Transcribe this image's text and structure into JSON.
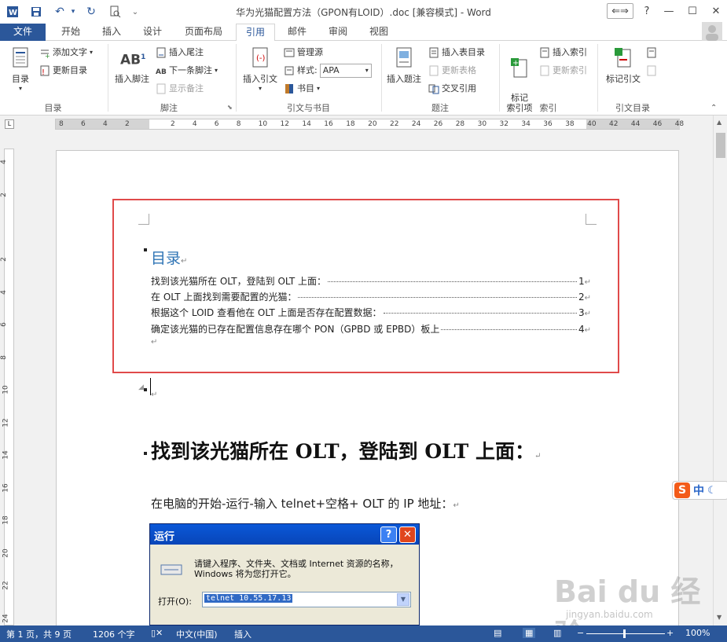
{
  "titlebar": {
    "doc_title": "华为光猫配置方法（GPON有LOID）.doc [兼容模式] - Word"
  },
  "tabs": {
    "file": "文件",
    "home": "开始",
    "insert": "插入",
    "design": "设计",
    "layout": "页面布局",
    "references": "引用",
    "mailings": "邮件",
    "review": "审阅",
    "view": "视图"
  },
  "ribbon": {
    "toc": {
      "toc_button": "目录",
      "add_text": "添加文字",
      "update_toc": "更新目录",
      "group_label": "目录"
    },
    "footnotes": {
      "insert_footnote": "插入脚注",
      "insert_endnote": "插入尾注",
      "next_footnote": "下一条脚注",
      "show_notes": "显示备注",
      "group_label": "脚注"
    },
    "citations": {
      "insert_citation": "插入引文",
      "manage_sources": "管理源",
      "style_label": "样式:",
      "style_value": "APA",
      "bibliography": "书目",
      "group_label": "引文与书目"
    },
    "captions": {
      "insert_caption": "插入题注",
      "insert_table_of_figures": "插入表目录",
      "update_table": "更新表格",
      "cross_reference": "交叉引用",
      "group_label": "题注"
    },
    "index": {
      "mark_entry": "标记\n索引项",
      "insert_index": "插入索引",
      "update_index": "更新索引",
      "group_label": "索引"
    },
    "authorities": {
      "mark_citation": "标记引文",
      "group_label": "引文目录"
    }
  },
  "hruler_ticks": [
    "8",
    "6",
    "4",
    "2",
    "2",
    "4",
    "6",
    "8",
    "10",
    "12",
    "14",
    "16",
    "18",
    "20",
    "22",
    "24",
    "26",
    "28",
    "30",
    "32",
    "34",
    "36",
    "38",
    "40",
    "42",
    "44",
    "46",
    "48"
  ],
  "vruler_ticks": [
    "4",
    "2",
    "2",
    "4",
    "6",
    "8",
    "10",
    "12",
    "14",
    "16",
    "18",
    "20",
    "22",
    "24"
  ],
  "document": {
    "toc_title": "目录",
    "toc_entries": [
      {
        "text": "找到该光猫所在 OLT，登陆到 OLT 上面：",
        "page": "1"
      },
      {
        "text": "在 OLT 上面找到需要配置的光猫：",
        "page": "2"
      },
      {
        "text": "根据这个 LOID 查看他在 OLT 上面是否存在配置数据：",
        "page": "3"
      },
      {
        "text": "确定该光猫的已存在配置信息存在哪个 PON（GPBD 或 EPBD）板上",
        "page": "4"
      }
    ],
    "heading1": "找到该光猫所在 OLT，登陆到 OLT 上面：",
    "body1": "在电脑的开始-运行-输入 telnet+空格+ OLT  的 IP 地址："
  },
  "run_dialog": {
    "title": "运行",
    "help_btn": "?",
    "close_btn": "✕",
    "message": "请键入程序、文件夹、文档或 Internet 资源的名称，Windows 将为您打开它。",
    "open_label": "打开(O):",
    "input_value": "telnet 10.55.17.13"
  },
  "ime": {
    "logo": "S",
    "mode": "中"
  },
  "watermark": {
    "main": "Bai du 经验",
    "sub": "jingyan.baidu.com"
  },
  "statusbar": {
    "page": "第 1 页，共 9 页",
    "words": "1206 个字",
    "language": "中文(中国)",
    "mode": "插入",
    "zoom": "100%"
  },
  "colors": {
    "word_blue": "#2b579a",
    "toc_heading": "#2e74b5",
    "highlight_box": "#e04a4a"
  }
}
